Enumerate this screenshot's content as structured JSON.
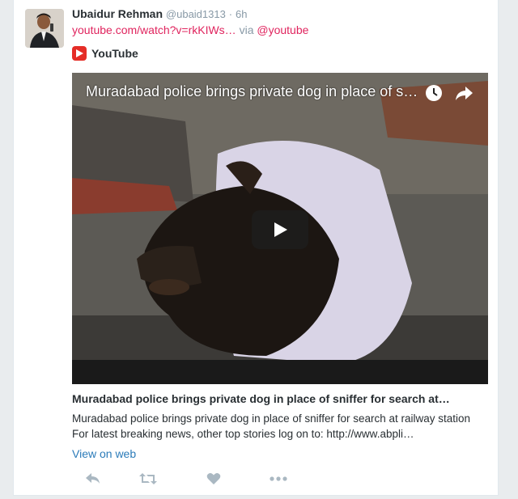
{
  "tweet": {
    "author_name": "Ubaidur Rehman",
    "author_handle": "@ubaid1313",
    "separator": "·",
    "timestamp": "6h",
    "link_text": "youtube.com/watch?v=rkKIWs…",
    "via_text": "via",
    "via_handle": "@youtube"
  },
  "card": {
    "provider": "YouTube",
    "video_title": "Muradabad police brings private dog in place of s…",
    "title": "Muradabad police brings private dog in place of sniffer for search at…",
    "description": "Muradabad police brings private dog in place of sniffer for search at railway station For latest breaking news, other top stories log on to: http://www.abpli…",
    "view_on_web": "View on web"
  },
  "actions": [
    "reply-icon",
    "retweet-icon",
    "like-icon",
    "more-icon"
  ],
  "colors": {
    "link": "#e0245e",
    "muted": "#8899a6",
    "view_link": "#2b7bb9",
    "youtube_red": "#e52d27",
    "text": "#292f33"
  }
}
